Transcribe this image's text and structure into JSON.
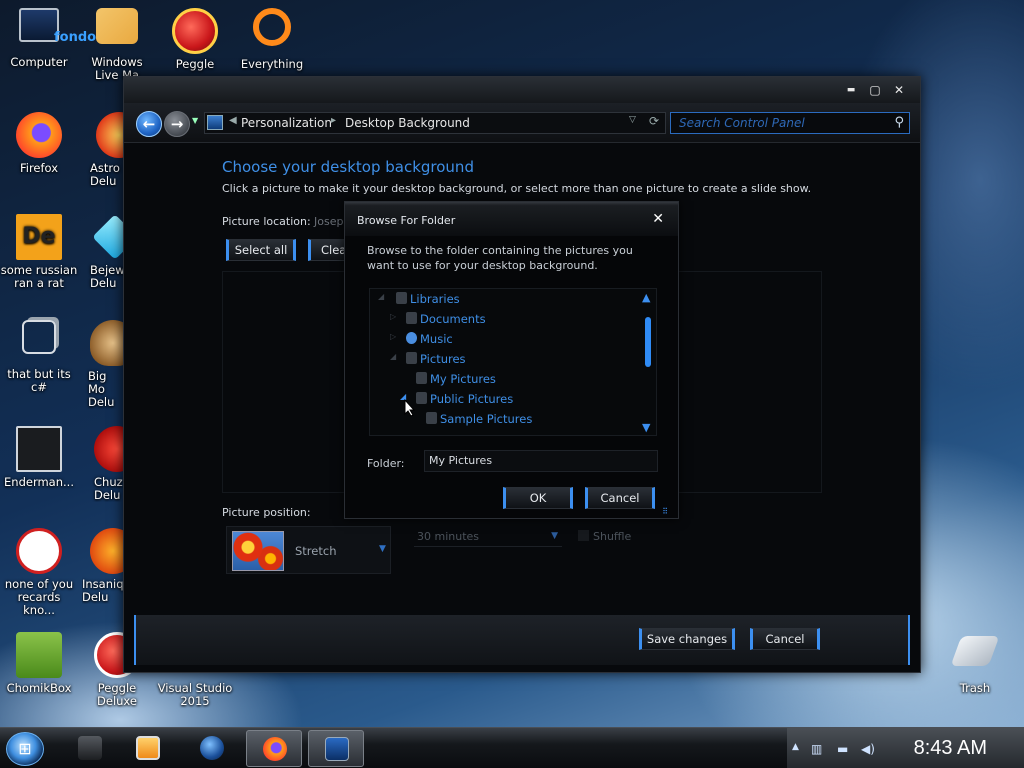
{
  "desktop": {
    "icons": [
      {
        "label": "Computer",
        "icon": "computer-icon"
      },
      {
        "label": "Windows Live Ma",
        "icon": "windows-live-icon"
      },
      {
        "label": "Peggle",
        "icon": "peggle-icon"
      },
      {
        "label": "Everything",
        "icon": "everything-search-icon"
      },
      {
        "label": "Firefox",
        "icon": "firefox-icon"
      },
      {
        "label": "Astro Delu",
        "icon": "astro-icon"
      },
      {
        "label": "some russian ran a rat",
        "icon": "de-icon"
      },
      {
        "label": "Bejew Delu",
        "icon": "bejeweled-icon"
      },
      {
        "label": "that but its c#",
        "icon": "windows-stack-icon"
      },
      {
        "label": "Big Mo Delu",
        "icon": "money-bag-icon"
      },
      {
        "label": "Enderman...",
        "icon": "terminal-icon"
      },
      {
        "label": "Chuz Delu",
        "icon": "chuzzle-icon"
      },
      {
        "label": "none of you recards kno...",
        "icon": "dragon-icon"
      },
      {
        "label": "Insaniq Delu",
        "icon": "insaniquarium-icon"
      },
      {
        "label": "ChomikBox",
        "icon": "chomikbox-icon"
      },
      {
        "label": "Peggle Deluxe",
        "icon": "peggle-deluxe-icon"
      },
      {
        "label": "Visual Studio 2015",
        "icon": "visual-studio-icon"
      },
      {
        "label": "Trash",
        "icon": "trash-icon"
      }
    ],
    "fondo_text": "fondo"
  },
  "window": {
    "controls": {
      "minimize": "▬",
      "maximize": "▢",
      "close": "✕"
    },
    "breadcrumbs": [
      "Personalization",
      "Desktop Background"
    ],
    "search_placeholder": "Search Control Panel",
    "heading": "Choose your desktop background",
    "subheading": "Click a picture to make it your desktop background, or select more than one picture to create a slide show.",
    "picture_location_label": "Picture location:",
    "picture_location_value": "Josep",
    "select_all": "Select all",
    "clear_all": "Clea",
    "picture_position_label": "Picture position:",
    "picture_position_value": "Stretch",
    "interval_value": "30 minutes",
    "shuffle_label": "Shuffle",
    "save_changes": "Save changes",
    "cancel": "Cancel"
  },
  "dialog": {
    "title": "Browse For Folder",
    "close": "✕",
    "instruction": "Browse to the folder containing the pictures you want to use for your desktop background.",
    "tree": [
      {
        "label": "Libraries",
        "icon": "libraries-icon"
      },
      {
        "label": "Documents",
        "icon": "documents-icon"
      },
      {
        "label": "Music",
        "icon": "music-icon"
      },
      {
        "label": "Pictures",
        "icon": "pictures-folder-icon"
      },
      {
        "label": "My Pictures",
        "icon": "folder-icon"
      },
      {
        "label": "Public Pictures",
        "icon": "folder-icon"
      },
      {
        "label": "Sample Pictures",
        "icon": "folder-icon"
      }
    ],
    "folder_label": "Folder:",
    "folder_value": "My Pictures",
    "ok": "OK",
    "cancel": "Cancel"
  },
  "taskbar": {
    "clock": "8:43 AM",
    "items": [
      "file-manager-icon",
      "media-player-icon",
      "globe-icon",
      "firefox-icon",
      "control-panel-icon"
    ],
    "active_item": "control-panel-icon"
  },
  "colors": {
    "accent": "#3c8ff0",
    "link": "#3f8fe6"
  }
}
